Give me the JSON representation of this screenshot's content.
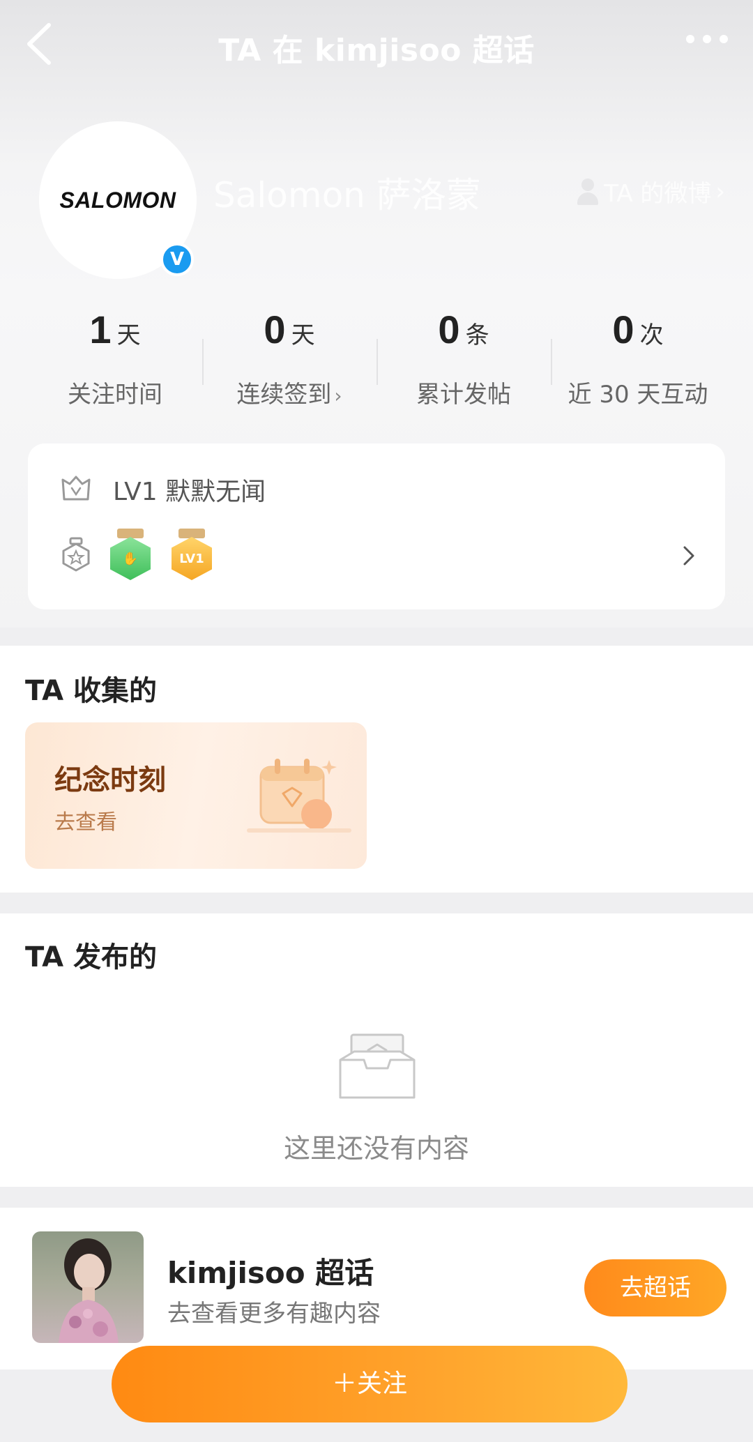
{
  "header": {
    "title": "TA 在 kimjisoo 超话",
    "back_icon": "back-arrow-icon",
    "more_icon": "more-dots-icon"
  },
  "profile": {
    "avatar_text": "SALOMON",
    "verified_mark": "V",
    "name": "Salomon 萨洛蒙",
    "weibo_link_label": "TA 的微博",
    "weibo_link_chevron": "›"
  },
  "stats": [
    {
      "value": "1",
      "unit": "天",
      "label": "关注时间",
      "chevron": ""
    },
    {
      "value": "0",
      "unit": "天",
      "label": "连续签到",
      "chevron": "›"
    },
    {
      "value": "0",
      "unit": "条",
      "label": "累计发帖",
      "chevron": ""
    },
    {
      "value": "0",
      "unit": "次",
      "label": "近 30 天互动",
      "chevron": ""
    }
  ],
  "level": {
    "text": "LV1 默默无闻",
    "lv_badge_text": "LV1",
    "badges": [
      "hand-badge-icon",
      "lv1-badge-icon"
    ]
  },
  "collected": {
    "title": "TA 收集的",
    "card_title": "纪念时刻",
    "card_sub": "去查看"
  },
  "posted": {
    "title": "TA 发布的",
    "empty_text": "这里还没有内容"
  },
  "topic": {
    "name": "kimjisoo 超话",
    "sub": "去查看更多有趣内容",
    "button": "去超话"
  },
  "follow_button": "＋关注",
  "colors": {
    "accent": "#ff8a1b",
    "verified": "#1a9bf0"
  }
}
